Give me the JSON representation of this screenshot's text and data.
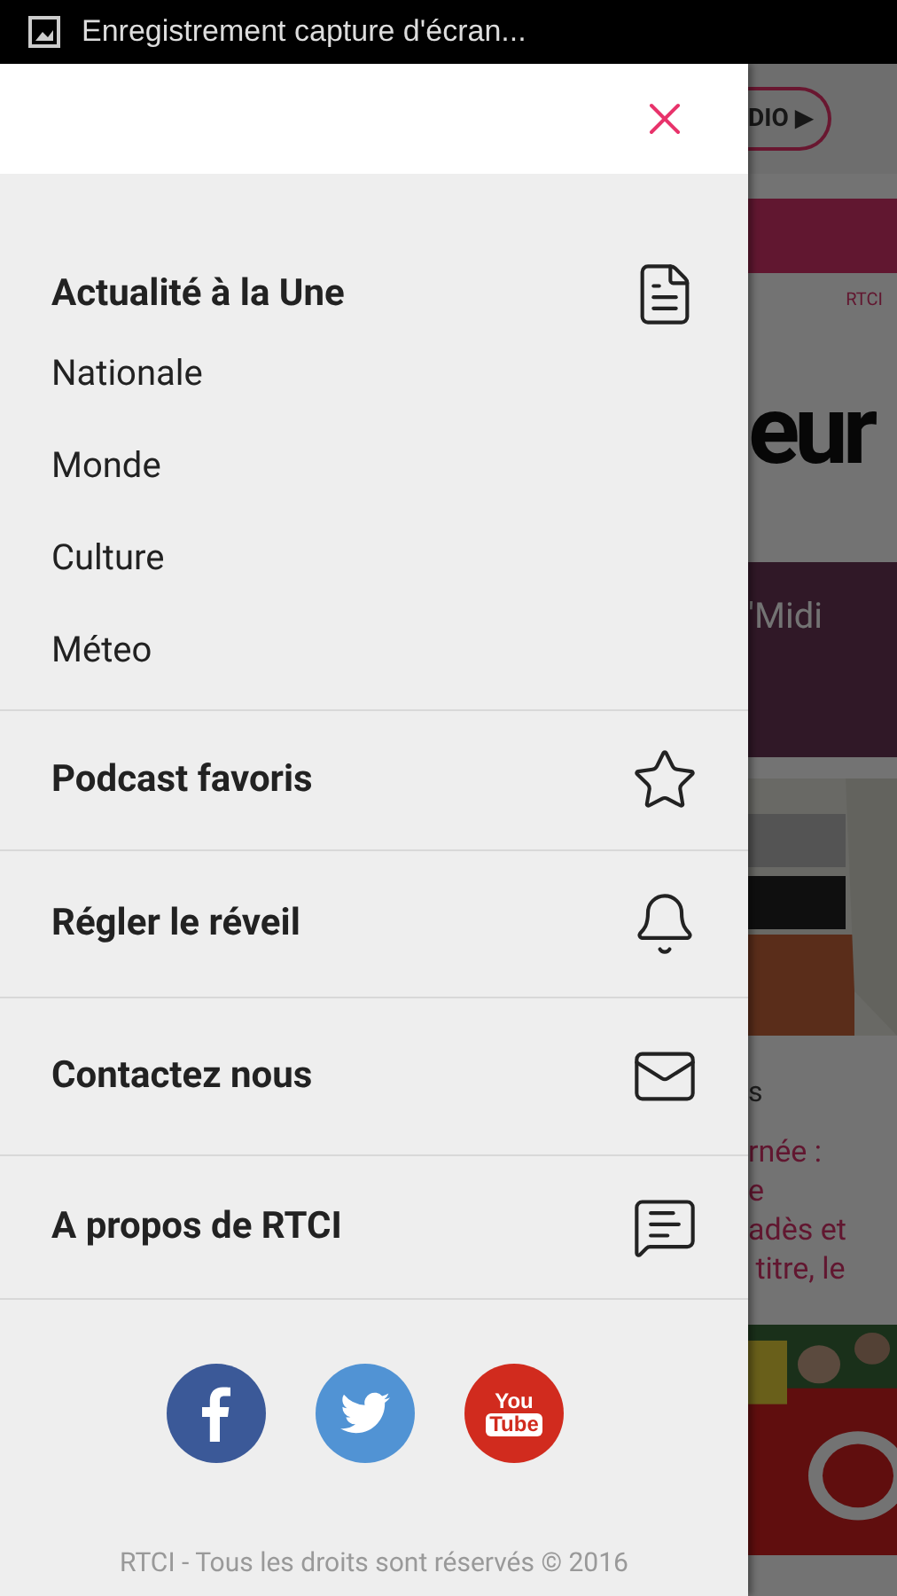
{
  "status_bar": {
    "notification": "Enregistrement capture d'écran..."
  },
  "drawer": {
    "menu": [
      {
        "label": "Actualité à la Une",
        "children": [
          {
            "label": "Nationale"
          },
          {
            "label": "Monde"
          },
          {
            "label": "Culture"
          },
          {
            "label": "Méteo"
          }
        ]
      },
      {
        "label": "Podcast favoris"
      },
      {
        "label": "Régler le réveil"
      },
      {
        "label": "Contactez nous"
      },
      {
        "label": "A propos de RTCI"
      }
    ],
    "social": {
      "youtube": [
        "You",
        "Tube"
      ]
    },
    "footer": "RTCI - Tous les droits sont réservés © 2016"
  },
  "background": {
    "radio_button": "DIO ▶",
    "logo": "RTCI",
    "headline": "eur",
    "banner": "'Midi",
    "caption": "s",
    "article_lines": [
      "rnée :",
      "e",
      "adès et",
      " titre, le"
    ]
  }
}
